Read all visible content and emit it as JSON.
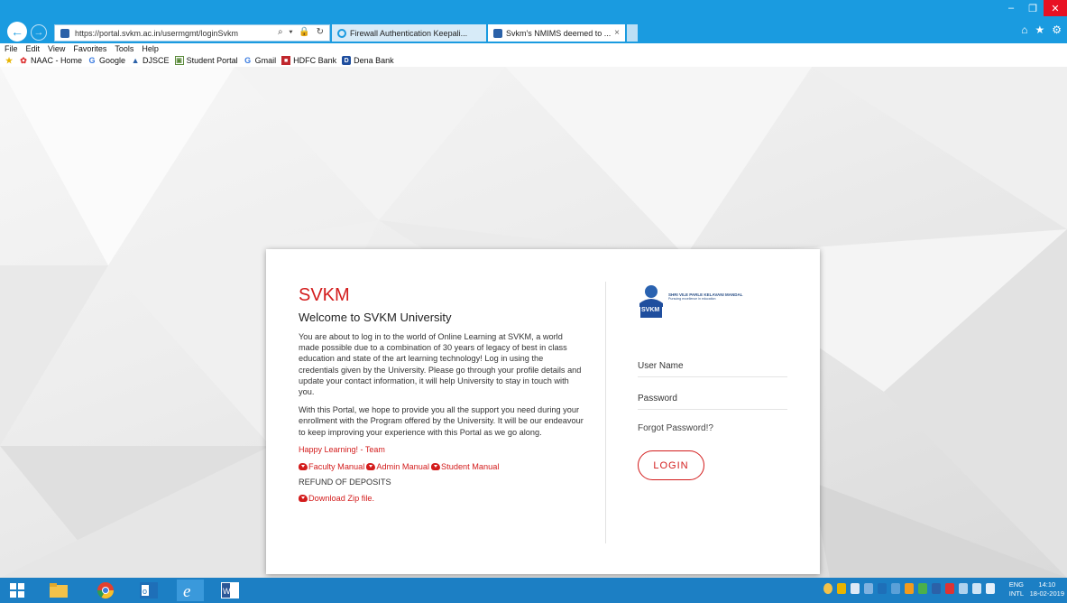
{
  "browser": {
    "url": "https://portal.svkm.ac.in/usermgmt/loginSvkm",
    "address_tools": "⌕ ▾ 🔒 ↻",
    "tabs": [
      {
        "label": "Firewall Authentication Keepali...",
        "active": false
      },
      {
        "label": "Svkm's NMIMS deemed to ...",
        "active": true,
        "close": "×"
      }
    ],
    "menu": [
      "File",
      "Edit",
      "View",
      "Favorites",
      "Tools",
      "Help"
    ],
    "favorites": [
      {
        "label": "NAAC - Home",
        "icon": "flower-icon",
        "color": "#d33"
      },
      {
        "label": "Google",
        "icon": "google-icon",
        "glyph": "G",
        "color": "#3a7be0"
      },
      {
        "label": "DJSCE",
        "icon": "djsce-icon",
        "color": "#2b61a8"
      },
      {
        "label": "Student Portal",
        "icon": "portal-icon",
        "color": "#5a8a3a"
      },
      {
        "label": "Gmail",
        "icon": "google-icon",
        "glyph": "G",
        "color": "#3a7be0"
      },
      {
        "label": "HDFC Bank",
        "icon": "hdfc-icon",
        "color": "#c0272d"
      },
      {
        "label": "Dena Bank",
        "icon": "dena-icon",
        "color": "#1f4e9e"
      }
    ]
  },
  "login_page": {
    "brand_title": "SVKM",
    "welcome": "Welcome to SVKM University",
    "paragraph1": "You are about to log in to the world of Online Learning at SVKM, a world made possible due to a combination of 30 years of legacy of best in class education and state of the art learning technology! Log in using the credentials given by the University. Please go through your profile details and update your contact information, it will help University to stay in touch with you.",
    "paragraph2": "With this Portal, we hope to provide you all the support you need during your enrollment with the Program offered by the University. It will be our endeavour to keep improving your experience with this Portal as we go along.",
    "happy_learning": "Happy Learning! - Team",
    "manuals": [
      "Faculty Manual",
      "Admin Manual",
      "Student Manual"
    ],
    "refund_heading": "REFUND OF DEPOSITS",
    "download_link": "Download Zip file.",
    "logo_name": "SHRI VILE PARLE KELAVANI MANDAL",
    "logo_tagline": "Pursuing excellence in education",
    "logo_badge": "SVKM",
    "username_placeholder": "User Name",
    "password_placeholder": "Password",
    "forgot_password": "Forgot Password!?",
    "login_button": "LOGIN",
    "accent_color": "#d31c1c"
  },
  "taskbar": {
    "language": "ENG",
    "language_sub": "INTL",
    "time": "14:10",
    "date": "18-02-2019"
  }
}
